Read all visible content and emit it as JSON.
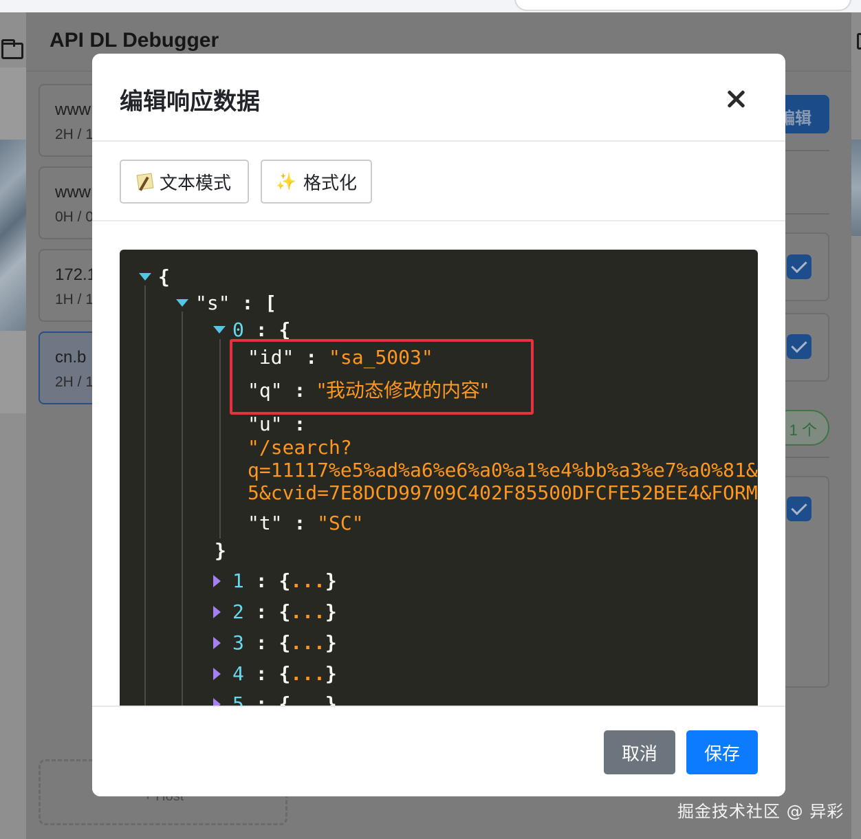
{
  "app": {
    "title": "API DL Debugger",
    "requests": [
      {
        "host": "www",
        "meta": "2H / 1"
      },
      {
        "host": "www",
        "meta": "0H / 0"
      },
      {
        "host": "172.1",
        "meta": "1H / 1"
      },
      {
        "host": "cn.b",
        "meta": "2H / 1"
      }
    ],
    "edit_button_label": "编辑",
    "count_pill": "1 个",
    "add_host_label": "+ Host"
  },
  "modal": {
    "title": "编辑响应数据",
    "toolbar": {
      "text_mode_label": "文本模式",
      "format_label": "格式化"
    },
    "json_view": {
      "open_brace": "{",
      "key_s": "\"s\"",
      "colon": ":",
      "open_bracket": "[",
      "item0_index": "0",
      "item0_open": "{",
      "id_key": "\"id\"",
      "id_value": "\"sa_5003\"",
      "q_key": "\"q\"",
      "q_value": "\"我动态修改的内容\"",
      "u_key": "\"u\"",
      "u_value_line1": "\"/search?",
      "u_value_line2": "q=11117%e5%ad%a6%e6%a0%a1%e4%bb%a3%e7%a0%81&",
      "u_value_line3": "5&cvid=7E8DCD99709C402F85500DFCFE52BEE4&FORM",
      "t_key": "\"t\"",
      "t_value": "\"SC\"",
      "item0_close": "}",
      "collapsed_items": [
        {
          "index": "1",
          "open": "{",
          "dots": "...",
          "close": "}"
        },
        {
          "index": "2",
          "open": "{",
          "dots": "...",
          "close": "}"
        },
        {
          "index": "3",
          "open": "{",
          "dots": "...",
          "close": "}"
        },
        {
          "index": "4",
          "open": "{",
          "dots": "...",
          "close": "}"
        },
        {
          "index": "5",
          "open": "{",
          "dots": "...",
          "close": "}"
        }
      ]
    },
    "footer": {
      "cancel_label": "取消",
      "save_label": "保存"
    }
  },
  "watermark": "掘金技术社区 @ 异彩"
}
